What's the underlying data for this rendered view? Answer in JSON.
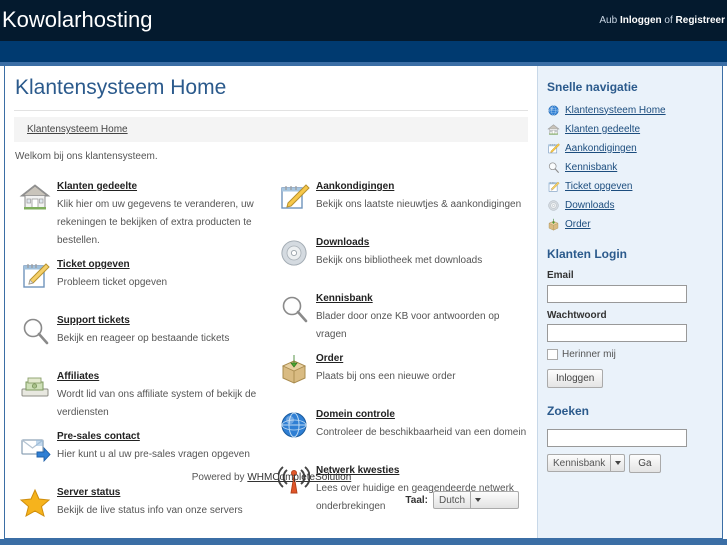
{
  "header": {
    "site_title": "Kowolarhosting",
    "auth_prefix": "Aub ",
    "auth_login": "Inloggen",
    "auth_sep": " of ",
    "auth_register": "Registreer"
  },
  "main": {
    "page_title": "Klantensysteem Home",
    "breadcrumb": "Klantensysteem Home",
    "welcome": "Welkom bij ons klantensysteem.",
    "services_left": [
      {
        "icon": "house-icon",
        "title": "Klanten gedeelte",
        "desc": "Klik hier om uw gegevens te veranderen, uw rekeningen te bekijken of extra producten te bestellen."
      },
      {
        "icon": "notepad-pencil-icon",
        "title": "Ticket opgeven",
        "desc": "Probleem ticket opgeven"
      },
      {
        "icon": "magnifier-icon",
        "title": "Support tickets",
        "desc": "Bekijk en reageer op bestaande tickets"
      },
      {
        "icon": "money-icon",
        "title": "Affiliates",
        "desc": "Wordt lid van ons affiliate system of bekijk de verdiensten"
      },
      {
        "icon": "envelope-arrow-icon",
        "title": "Pre-sales contact",
        "desc": "Hier kunt u al uw pre-sales vragen opgeven"
      },
      {
        "icon": "star-icon",
        "title": "Server status",
        "desc": "Bekijk de live status info van onze servers"
      }
    ],
    "services_right": [
      {
        "icon": "announcement-icon",
        "title": "Aankondigingen",
        "desc": "Bekijk ons laatste nieuwtjes & aankondigingen"
      },
      {
        "icon": "disc-icon",
        "title": "Downloads",
        "desc": "Bekijk ons bibliotheek met downloads"
      },
      {
        "icon": "magnifier-icon",
        "title": "Kennisbank",
        "desc": "Blader door onze KB voor antwoorden op vragen"
      },
      {
        "icon": "box-icon",
        "title": "Order",
        "desc": "Plaats bij ons een nieuwe order"
      },
      {
        "icon": "globe-icon",
        "title": "Domein controle",
        "desc": "Controleer de beschikbaarheid van een domein"
      },
      {
        "icon": "broadcast-icon",
        "title": "Netwerk kwesties",
        "desc": "Lees over huidige en geagendeerde netwerk onderbrekingen"
      }
    ],
    "powered_prefix": "Powered by ",
    "powered_link": "WHMCompleteSolution",
    "language_label": "Taal:",
    "language_value": "Dutch"
  },
  "sidebar": {
    "nav_heading": "Snelle navigatie",
    "nav_items": [
      {
        "icon": "globe-icon",
        "label": "Klantensysteem Home"
      },
      {
        "icon": "house-icon",
        "label": "Klanten gedeelte"
      },
      {
        "icon": "announcement-icon",
        "label": "Aankondigingen"
      },
      {
        "icon": "magnifier-icon",
        "label": "Kennisbank"
      },
      {
        "icon": "notepad-pencil-icon",
        "label": "Ticket opgeven"
      },
      {
        "icon": "disc-icon",
        "label": "Downloads"
      },
      {
        "icon": "box-icon",
        "label": "Order"
      }
    ],
    "login_heading": "Klanten Login",
    "email_label": "Email",
    "email_value": "",
    "password_label": "Wachtwoord",
    "password_value": "",
    "remember_label": "Herinner mij",
    "login_button": "Inloggen",
    "search_heading": "Zoeken",
    "search_value": "",
    "search_scope": "Kennisbank",
    "search_go": "Ga"
  },
  "colors": {
    "header_dark": "#041a2e",
    "header_blue": "#003a70",
    "border_blue": "#3b6ea5",
    "title_blue": "#2b5a8c",
    "sidebar_bg": "#eaf2fa"
  }
}
